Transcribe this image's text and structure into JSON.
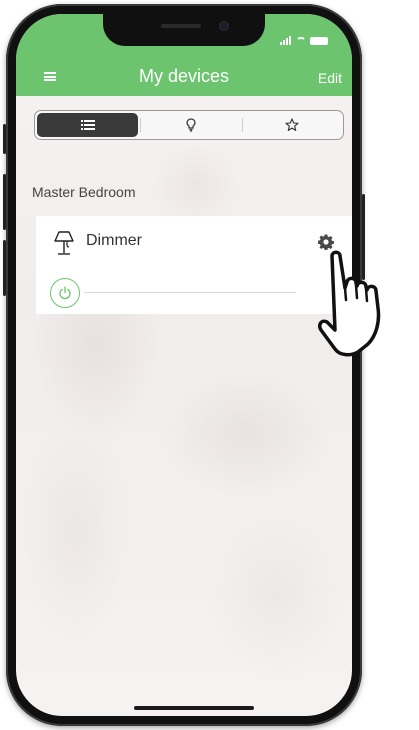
{
  "header": {
    "title": "My devices",
    "edit_label": "Edit",
    "bg_color": "#6cc56e"
  },
  "segmented_control": {
    "selected_index": 0,
    "items": [
      {
        "icon": "list-icon"
      },
      {
        "icon": "bulb-icon"
      },
      {
        "icon": "star-icon"
      }
    ]
  },
  "room": {
    "label": "Master Bedroom"
  },
  "device": {
    "name": "Dimmer",
    "icon": "lamp-icon",
    "power_icon": "power-icon",
    "settings_icon": "gear-icon",
    "dimmer_level": 0
  },
  "overlay": {
    "pointer_icon": "pointing-hand-icon"
  }
}
